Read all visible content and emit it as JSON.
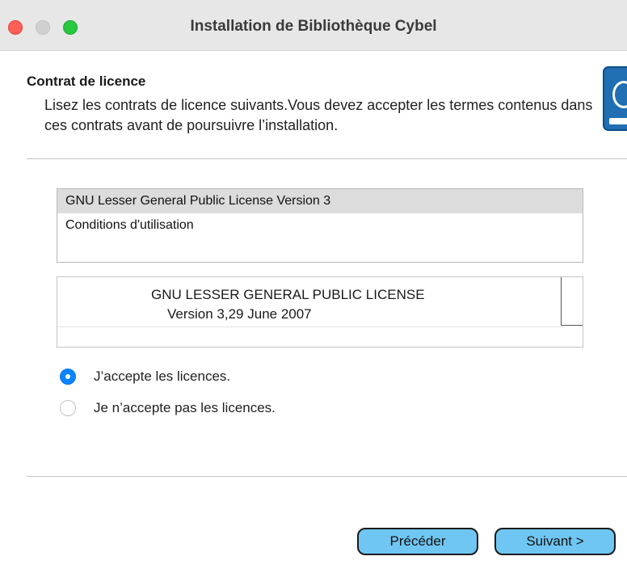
{
  "window": {
    "title": "Installation de Bibliothèque Cybel"
  },
  "header": {
    "title": "Contrat de licence",
    "description": "Lisez les contrats de licence suivants.Vous devez accepter les termes contenus dans ces contrats avant de poursuivre l’installation.",
    "icon": "book-icon"
  },
  "licenses": {
    "items": [
      {
        "label": "GNU Lesser General Public License Version 3",
        "selected": true
      },
      {
        "label": "Conditions d'utilisation",
        "selected": false
      }
    ]
  },
  "license_text": {
    "line1": "GNU LESSER GENERAL PUBLIC LICENSE",
    "line2": "Version 3,29 June 2007"
  },
  "options": {
    "accept_label": "J’accepte les licences.",
    "decline_label": "Je n’accepte pas les licences.",
    "selected": "accept"
  },
  "buttons": {
    "previous_label": "Précéder",
    "next_label": "Suivant >"
  },
  "colors": {
    "accent": "#0a84ff",
    "button": "#6fc6f2",
    "close": "#fe5f57",
    "maximize": "#28c840"
  }
}
